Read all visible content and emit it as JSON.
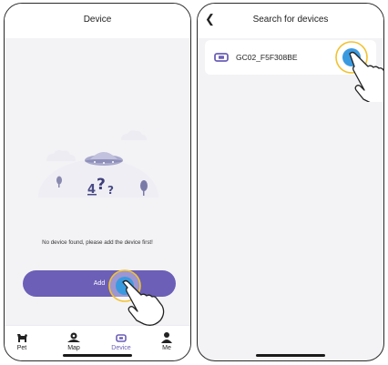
{
  "left_screen": {
    "title": "Device",
    "empty_message": "No device found, please add the device first!",
    "add_button_label": "Add",
    "tabs": [
      {
        "label": "Pet",
        "icon": "dog-icon",
        "active": false
      },
      {
        "label": "Map",
        "icon": "map-pin-icon",
        "active": false
      },
      {
        "label": "Device",
        "icon": "device-icon",
        "active": true
      },
      {
        "label": "Me",
        "icon": "person-icon",
        "active": false
      }
    ]
  },
  "right_screen": {
    "title": "Search for devices",
    "back_icon": "chevron-left-icon",
    "devices": [
      {
        "name": "GC02_F5F308BE",
        "icon": "device-icon"
      }
    ]
  },
  "colors": {
    "accent": "#6b5fb7",
    "tap_ring": "#f2c230",
    "tap_dot": "#3a9ae0"
  }
}
